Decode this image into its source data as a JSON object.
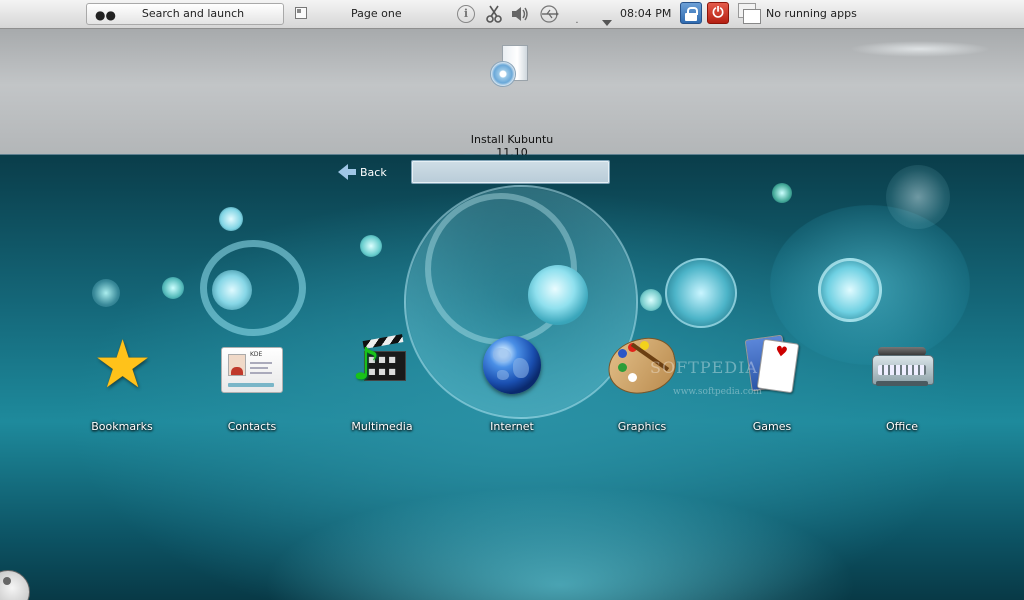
{
  "panel": {
    "search_launch_label": "Search and launch",
    "page_label": "Page one",
    "clock": "08:04 PM",
    "tasks_label": "No running apps",
    "icons": [
      "binoculars-icon",
      "pager-icon",
      "info-icon",
      "clipboard-scissors-icon",
      "volume-icon",
      "usb-icon",
      "lock-screen-icon",
      "power-icon",
      "windows-icon"
    ]
  },
  "desktop": {
    "install_label_line1": "Install Kubuntu",
    "install_label_line2": "11.10"
  },
  "launcher": {
    "back_label": "Back",
    "search_value": "",
    "categories": [
      {
        "label": "Bookmarks",
        "icon": "star-icon"
      },
      {
        "label": "Contacts",
        "icon": "contact-card-icon"
      },
      {
        "label": "Multimedia",
        "icon": "clapperboard-icon"
      },
      {
        "label": "Internet",
        "icon": "globe-icon"
      },
      {
        "label": "Graphics",
        "icon": "palette-icon"
      },
      {
        "label": "Games",
        "icon": "playing-cards-icon"
      },
      {
        "label": "Office",
        "icon": "typewriter-icon"
      }
    ]
  },
  "watermark": {
    "text": "SOFTPEDIA",
    "sub": "www.softpedia.com"
  },
  "contacts_card": {
    "line1": "KDE"
  },
  "colors": {
    "accent_blue": "#2f6bb0",
    "power_red": "#b51f13",
    "background_teal": "#15697b"
  }
}
